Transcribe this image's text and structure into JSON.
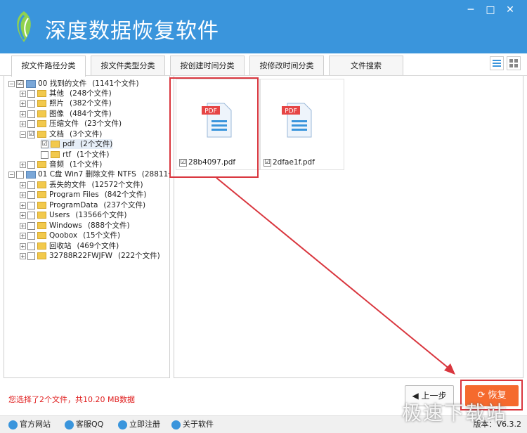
{
  "app": {
    "title": "深度数据恢复软件",
    "version": "版本：V6.3.2"
  },
  "window": {
    "min_symbol": "─",
    "max_symbol": "□",
    "close_symbol": "✕"
  },
  "tabs": [
    {
      "label": "按文件路径分类"
    },
    {
      "label": "按文件类型分类"
    },
    {
      "label": "按创建时间分类"
    },
    {
      "label": "按修改时间分类"
    },
    {
      "label": "文件搜索"
    }
  ],
  "tree": [
    {
      "name": "00 找到的文件",
      "count": "(1141个文件)"
    },
    {
      "name": "其他",
      "count": "(248个文件)"
    },
    {
      "name": "照片",
      "count": "(382个文件)"
    },
    {
      "name": "图像",
      "count": "(484个文件)"
    },
    {
      "name": "压缩文件",
      "count": "(23个文件)"
    },
    {
      "name": "文档",
      "count": "(3个文件)"
    },
    {
      "name": "pdf",
      "count": "(2个文件)"
    },
    {
      "name": "rtf",
      "count": "(1个文件)"
    },
    {
      "name": "音频",
      "count": "(1个文件)"
    },
    {
      "name": "01 C盘 Win7 删除文件 NTFS",
      "count": "(28811个文"
    },
    {
      "name": "丢失的文件",
      "count": "(12572个文件)"
    },
    {
      "name": "Program Files",
      "count": "(842个文件)"
    },
    {
      "name": "ProgramData",
      "count": "(237个文件)"
    },
    {
      "name": "Users",
      "count": "(13566个文件)"
    },
    {
      "name": "Windows",
      "count": "(888个文件)"
    },
    {
      "name": "Qoobox",
      "count": "(15个文件)"
    },
    {
      "name": "回收站",
      "count": "(469个文件)"
    },
    {
      "name": "32788R22FWJFW",
      "count": "(222个文件)"
    }
  ],
  "files": [
    {
      "name": "28b4097.pdf",
      "badge": "PDF",
      "checked": "☑"
    },
    {
      "name": "2dfae1f.pdf",
      "badge": "PDF",
      "checked": "☑"
    }
  ],
  "status": {
    "text": "您选择了2个文件，共10.20 MB数据"
  },
  "buttons": {
    "prev": "上一步",
    "recover": "恢复"
  },
  "footer": {
    "site": "官方网站",
    "qq": "客服QQ",
    "register": "立即注册",
    "about": "关于软件"
  },
  "watermark": "极速下载站",
  "colors": {
    "header": "#3a95dc",
    "accent": "#f56a2e",
    "highlight": "#d9363e",
    "status": "#e02020"
  }
}
